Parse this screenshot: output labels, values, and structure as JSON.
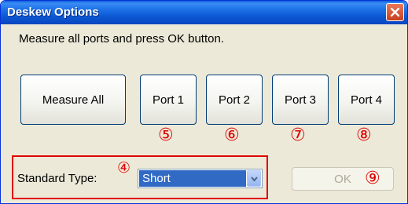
{
  "window": {
    "title": "Deskew Options"
  },
  "instruction": "Measure all ports and press OK button.",
  "buttons": {
    "measure_all": "Measure All",
    "port1": "Port 1",
    "port2": "Port 2",
    "port3": "Port 3",
    "port4": "Port 4",
    "ok": "OK"
  },
  "standard_type": {
    "label": "Standard Type:",
    "selected": "Short"
  },
  "annotations": {
    "n4": "④",
    "n5": "⑤",
    "n6": "⑥",
    "n7": "⑦",
    "n8": "⑧",
    "n9": "⑨"
  },
  "colors": {
    "titlebar": "#0a56d0",
    "annotation_red": "#e00000",
    "selection": "#316ac5"
  }
}
